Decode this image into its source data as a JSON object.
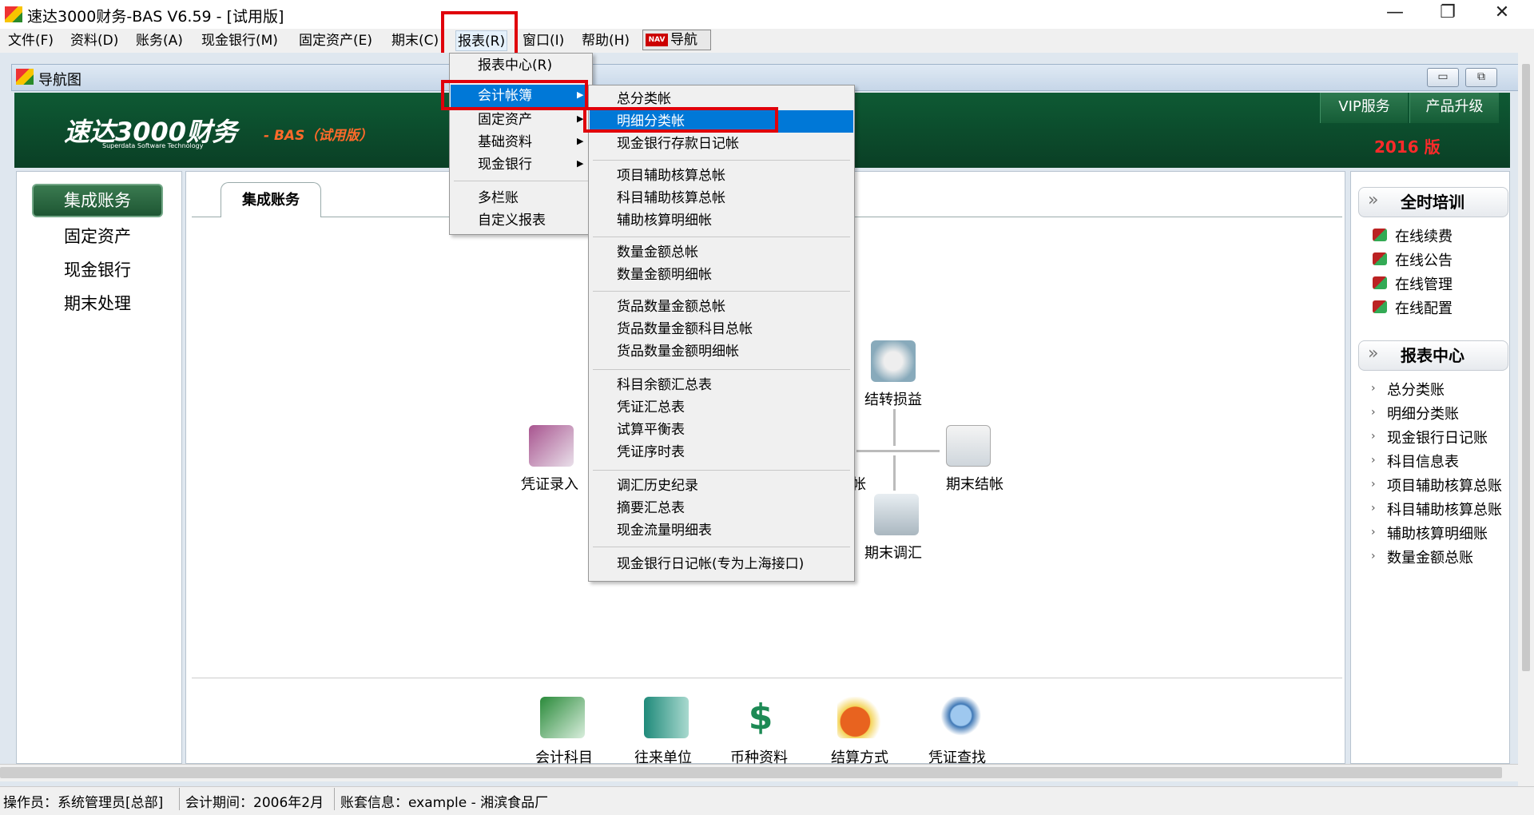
{
  "window": {
    "title": "速达3000财务-BAS V6.59 - [试用版]",
    "minimize": "—",
    "maximize": "❐",
    "close": "✕"
  },
  "menubar": {
    "items": [
      "文件(F)",
      "资料(D)",
      "账务(A)",
      "现金银行(M)",
      "固定资产(E)",
      "期末(C)",
      "报表(R)",
      "窗口(I)",
      "帮助(H)"
    ],
    "nav_label": "导航",
    "nav_icon_text": "NAV"
  },
  "inner_window": {
    "title": "导航图",
    "min": "▭",
    "restore": "⧉"
  },
  "banner": {
    "logo": "速达3000财务",
    "logo_sub": "Superdata Software Technology",
    "edition": "- BAS（试用版）",
    "vip": "VIP服务",
    "upgrade": "产品升级",
    "year": "2016 版"
  },
  "left_nav": {
    "active": "集成账务",
    "items": [
      "固定资产",
      "现金银行",
      "期末处理"
    ]
  },
  "center": {
    "tab": "集成账务",
    "flow": {
      "voucher_entry": "凭证录入",
      "transfer_pl": "结转损益",
      "period_close": "期末结帐",
      "period_adjust": "期末调汇",
      "partial_label": "帐"
    },
    "bottom": [
      "会计科目",
      "往来单位",
      "币种资料",
      "结算方式",
      "凭证查找"
    ]
  },
  "right_panel": {
    "training_header": "全时培训",
    "training_items": [
      "在线续费",
      "在线公告",
      "在线管理",
      "在线配置"
    ],
    "reports_header": "报表中心",
    "report_items": [
      "总分类账",
      "明细分类账",
      "现金银行日记账",
      "科目信息表",
      "项目辅助核算总账",
      "科目辅助核算总账",
      "辅助核算明细账",
      "数量金额总账"
    ]
  },
  "report_menu": {
    "items": [
      "报表中心(R)",
      "会计帐簿",
      "固定资产",
      "基础资料",
      "现金银行",
      "多栏账",
      "自定义报表"
    ]
  },
  "ledger_submenu": {
    "group1": [
      "总分类帐",
      "明细分类帐",
      "现金银行存款日记帐"
    ],
    "group2": [
      "项目辅助核算总帐",
      "科目辅助核算总帐",
      "辅助核算明细帐"
    ],
    "group3": [
      "数量金额总帐",
      "数量金额明细帐"
    ],
    "group4": [
      "货品数量金额总帐",
      "货品数量金额科目总帐",
      "货品数量金额明细帐"
    ],
    "group5": [
      "科目余额汇总表",
      "凭证汇总表",
      "试算平衡表",
      "凭证序时表"
    ],
    "group6": [
      "调汇历史纪录",
      "摘要汇总表",
      "现金流量明细表"
    ],
    "group7": [
      "现金银行日记帐(专为上海接口)"
    ]
  },
  "status": {
    "operator": "操作员：系统管理员[总部]",
    "period": "会计期间：2006年2月",
    "account": "账套信息：example - 湘滨食品厂"
  },
  "colors": {
    "banner": "#0e5a34",
    "highlight": "#0078d7",
    "annotation": "#e0000b"
  }
}
